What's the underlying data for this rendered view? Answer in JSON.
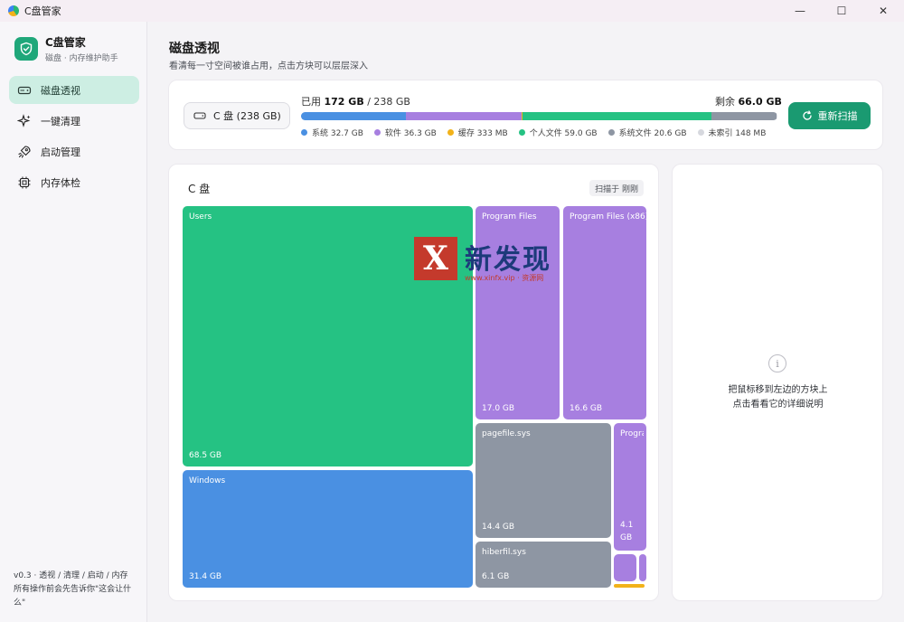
{
  "window": {
    "title": "C盘管家",
    "controls": {
      "minimize": "—",
      "maximize": "☐",
      "close": "✕"
    }
  },
  "sidebar": {
    "brand_name": "C盘管家",
    "brand_sub": "磁盘 · 内存维护助手",
    "items": [
      {
        "label": "磁盘透视",
        "icon": "drive-icon",
        "active": true
      },
      {
        "label": "一键清理",
        "icon": "sparkle-icon",
        "active": false
      },
      {
        "label": "启动管理",
        "icon": "rocket-icon",
        "active": false
      },
      {
        "label": "内存体检",
        "icon": "chip-icon",
        "active": false
      }
    ],
    "footer": "v0.3 · 透视 / 清理 / 启动 / 内存 所有操作前会先告诉你\"这会让什么\""
  },
  "header": {
    "title": "磁盘透视",
    "subtitle": "看清每一寸空间被谁占用，点击方块可以层层深入"
  },
  "disk": {
    "drive_label": "C 盘 (238 GB)",
    "used_prefix": "已用 ",
    "used_value": "172 GB",
    "used_total": " / 238 GB",
    "free_prefix": "剩余 ",
    "free_value": "66.0 GB",
    "rescan_label": "重新扫描",
    "segments": [
      {
        "name": "系统",
        "value_gb": 32.7,
        "color": "#4a90e2"
      },
      {
        "name": "软件",
        "value_gb": 36.3,
        "color": "#a77fe0"
      },
      {
        "name": "缓存",
        "value_gb": 0.333,
        "color": "#f2b21a"
      },
      {
        "name": "个人文件",
        "value_gb": 59.0,
        "color": "#25c283"
      },
      {
        "name": "系统文件",
        "value_gb": 20.6,
        "color": "#8e96a3"
      },
      {
        "name": "未索引",
        "value_gb": 0.14,
        "color": "#e3e5ea"
      }
    ],
    "legend": [
      {
        "label": "系统 32.7 GB",
        "color": "#4a90e2"
      },
      {
        "label": "软件 36.3 GB",
        "color": "#a77fe0"
      },
      {
        "label": "缓存 333 MB",
        "color": "#f2b21a"
      },
      {
        "label": "个人文件 59.0 GB",
        "color": "#25c283"
      },
      {
        "label": "系统文件 20.6 GB",
        "color": "#8e96a3"
      },
      {
        "label": "未索引 148 MB",
        "color": "#d6d8de"
      }
    ]
  },
  "treemap": {
    "title": "C 盘",
    "sort_label": "扫描于 刚刚",
    "tiles": [
      {
        "name": "Users",
        "size": "68.5 GB",
        "color": "#25c283"
      },
      {
        "name": "Windows",
        "size": "31.4 GB",
        "color": "#4a90e2"
      },
      {
        "name": "Program Files",
        "size": "17.0 GB",
        "color": "#a77fe0"
      },
      {
        "name": "Program Files (x86)",
        "size": "16.6 GB",
        "color": "#a77fe0"
      },
      {
        "name": "pagefile.sys",
        "size": "14.4 GB",
        "color": "#8e96a3"
      },
      {
        "name": "ProgramData",
        "size": "4.1 GB",
        "color": "#a77fe0"
      },
      {
        "name": "hiberfil.sys",
        "size": "6.1 GB",
        "color": "#8e96a3"
      },
      {
        "name": "",
        "size": "",
        "color": "#a77fe0"
      },
      {
        "name": "",
        "size": "",
        "color": "#a77fe0"
      },
      {
        "name": "",
        "size": "",
        "color": "#f2b21a"
      }
    ]
  },
  "details": {
    "info_glyph": "i",
    "hint_line1": "把鼠标移到左边的方块上",
    "hint_line2": "点击看看它的详细说明"
  },
  "watermark": {
    "logo_letter": "X",
    "name": "新发现",
    "url": "www.xinfx.vip · 资源网"
  }
}
